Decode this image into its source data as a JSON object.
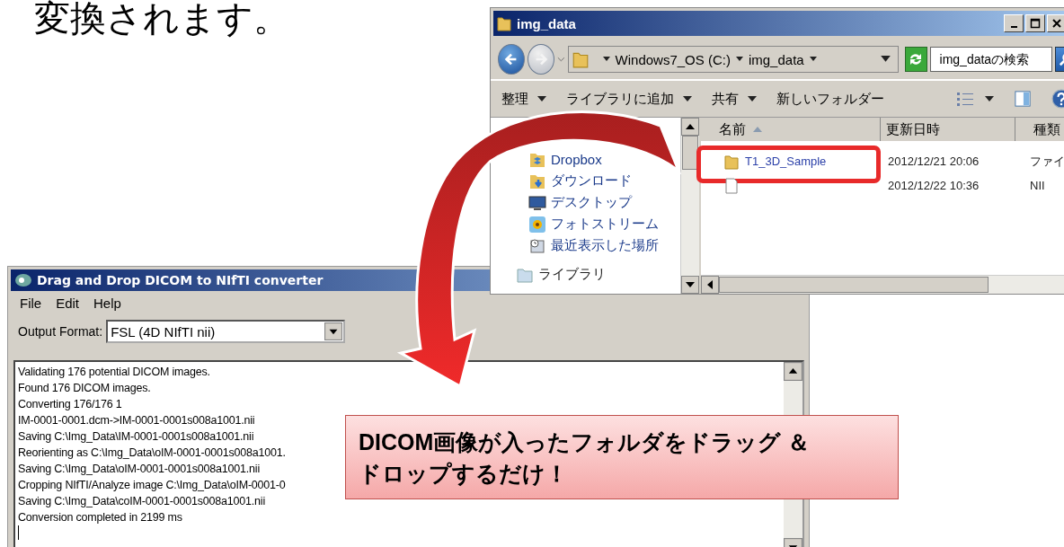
{
  "slide_text": "変換されます。",
  "explorer": {
    "title": "img_data",
    "breadcrumb": [
      "Windows7_OS (C:)",
      "img_data"
    ],
    "search": {
      "placeholder": "img_dataの検索"
    },
    "toolbar": [
      {
        "label": "整理",
        "dropdown": true
      },
      {
        "label": "ライブラリに追加",
        "dropdown": true
      },
      {
        "label": "共有",
        "dropdown": true
      },
      {
        "label": "新しいフォルダー",
        "dropdown": false
      }
    ],
    "nav": [
      {
        "label": "Dropbox",
        "kind": "dropbox"
      },
      {
        "label": "ダウンロード",
        "kind": "download"
      },
      {
        "label": "デスクトップ",
        "kind": "desktop"
      },
      {
        "label": "フォトストリーム",
        "kind": "photo"
      },
      {
        "label": "最近表示した場所",
        "kind": "recent"
      },
      {
        "label": "ライブラリ",
        "kind": "library"
      }
    ],
    "columns": [
      {
        "label": "名前",
        "sorted": true
      },
      {
        "label": "更新日時",
        "sorted": false
      },
      {
        "label": "種類",
        "sorted": false
      }
    ],
    "rows": [
      {
        "kind": "folder",
        "name": "T1_3D_Sample",
        "modified": "2012/12/21 20:06",
        "type": "ファイ",
        "highlighted": true
      },
      {
        "kind": "file",
        "modified": "2012/12/22 10:36",
        "type": "NII",
        "highlighted": false
      }
    ]
  },
  "converter": {
    "title": "Drag and Drop DICOM to NIfTI converter",
    "menu": [
      "File",
      "Edit",
      "Help"
    ],
    "output_format": {
      "label": "Output Format:",
      "value": "FSL (4D NIfTI nii)"
    },
    "log": [
      "Validating 176 potential DICOM images.",
      "Found 176 DICOM images.",
      "Converting 176/176  1",
      "IM-0001-0001.dcm->IM-0001-0001s008a1001.nii",
      "Saving C:\\Img_Data\\IM-0001-0001s008a1001.nii",
      "Reorienting as C:\\Img_Data\\oIM-0001-0001s008a1001.",
      "Saving C:\\Img_Data\\oIM-0001-0001s008a1001.nii",
      "Cropping NIfTI/Analyze image C:\\Img_Data\\oIM-0001-0",
      "Saving C:\\Img_Data\\coIM-0001-0001s008a1001.nii",
      "Conversion completed in 2199 ms"
    ]
  },
  "callout": [
    "DICOM画像が入ったフォルダをドラッグ ＆",
    "ドロップするだけ！"
  ]
}
